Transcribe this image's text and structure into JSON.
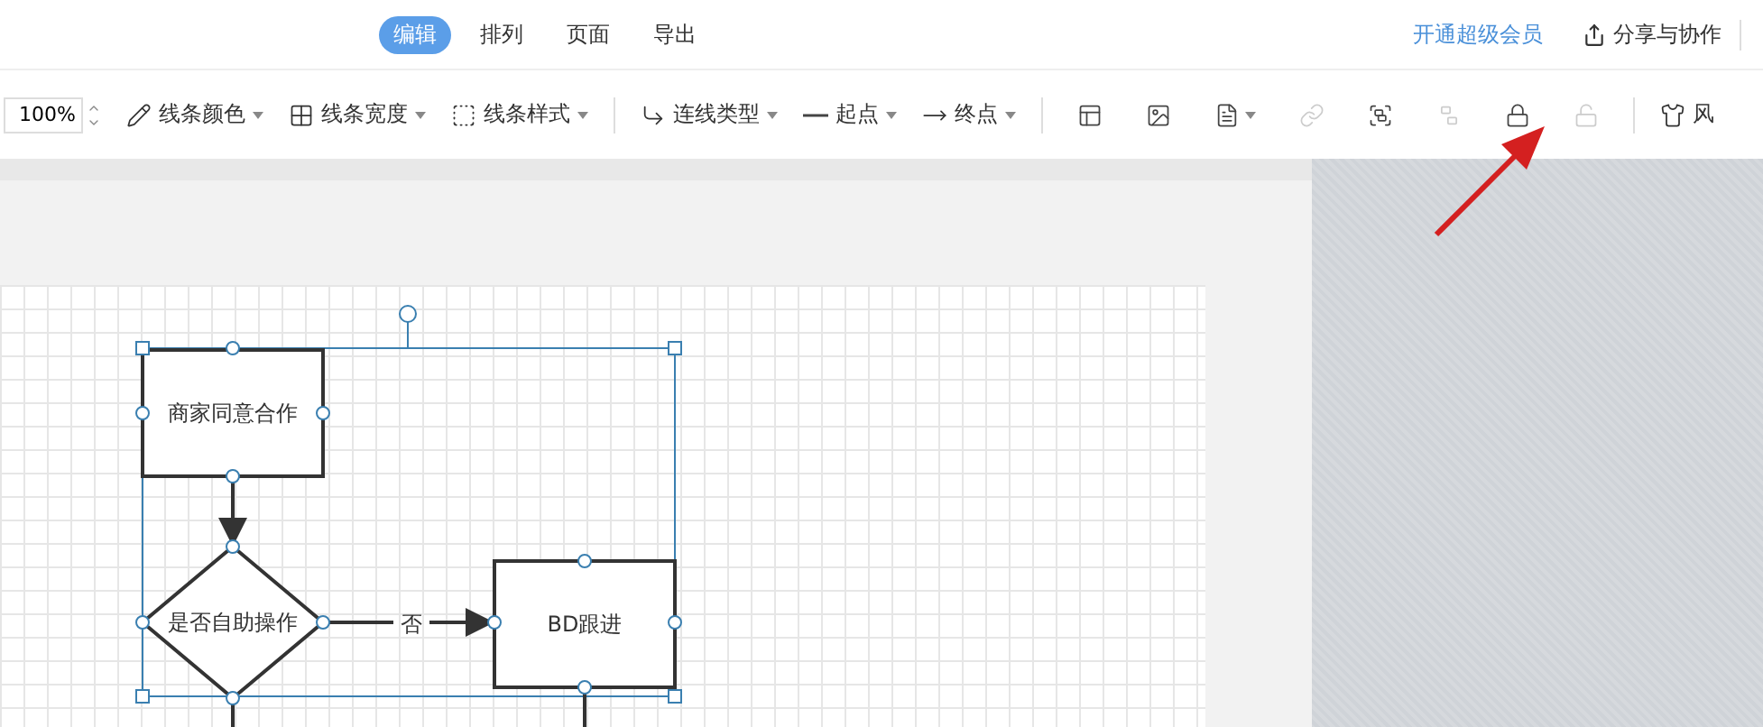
{
  "tabs": [
    {
      "label": "编辑",
      "selected": true
    },
    {
      "label": "排列",
      "selected": false
    },
    {
      "label": "页面",
      "selected": false
    },
    {
      "label": "导出",
      "selected": false
    }
  ],
  "header_actions": [
    {
      "kind": "link",
      "label": "开通超级会员"
    },
    {
      "kind": "share",
      "label": "分享与协作"
    }
  ],
  "toolbar": [
    {
      "kind": "zoom",
      "value": "100%"
    },
    {
      "kind": "dropdown",
      "label": "线条颜色"
    },
    {
      "kind": "dropdown",
      "label": "线条宽度"
    },
    {
      "kind": "dropdown",
      "label": "线条样式"
    },
    {
      "kind": "separator"
    },
    {
      "kind": "dropdown",
      "label": "连线类型"
    },
    {
      "kind": "dropdown",
      "label": "起点"
    },
    {
      "kind": "dropdown",
      "label": "终点"
    },
    {
      "kind": "separator"
    },
    {
      "kind": "icon",
      "disabled": false
    },
    {
      "kind": "icon",
      "disabled": false
    },
    {
      "kind": "icon-menu",
      "disabled": false
    },
    {
      "kind": "icon",
      "disabled": true
    },
    {
      "kind": "icon",
      "disabled": false
    },
    {
      "kind": "icon",
      "disabled": true
    },
    {
      "kind": "icon",
      "disabled": false
    },
    {
      "kind": "icon",
      "disabled": true
    },
    {
      "kind": "separator"
    },
    {
      "kind": "labeled",
      "label": "风"
    }
  ],
  "diagram": {
    "nodes": [
      {
        "kind": "process",
        "label": "商家同意合作"
      },
      {
        "kind": "decision",
        "label": "是否自助操作"
      },
      {
        "kind": "process",
        "label": "BD跟进"
      }
    ],
    "edge_label": "否"
  }
}
